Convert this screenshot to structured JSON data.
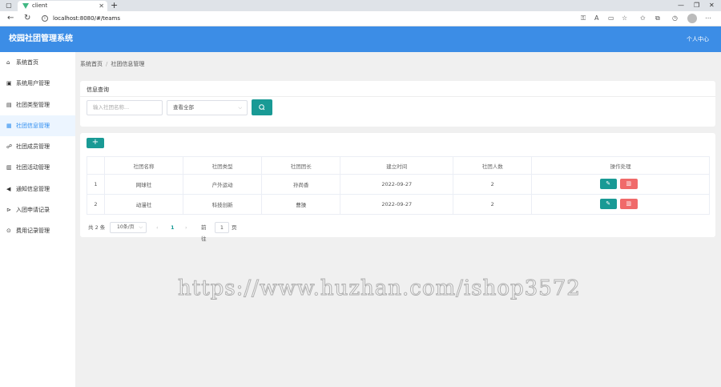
{
  "browser": {
    "tab_title": "client",
    "url": "localhost:8080/#/teams"
  },
  "app": {
    "title": "校园社团管理系统",
    "user_menu": "个人中心",
    "accent": "#3c8de6",
    "primary_button": "#199a95",
    "danger_button": "#f06a6a"
  },
  "sidebar": {
    "items": [
      {
        "label": "系统首页",
        "icon": "home-icon"
      },
      {
        "label": "系统用户管理",
        "icon": "user-icon"
      },
      {
        "label": "社团类型管理",
        "icon": "list-icon"
      },
      {
        "label": "社团信息管理",
        "icon": "doc-icon",
        "active": true
      },
      {
        "label": "社团成员管理",
        "icon": "members-icon"
      },
      {
        "label": "社团活动管理",
        "icon": "calendar-icon"
      },
      {
        "label": "通知信息管理",
        "icon": "megaphone-icon"
      },
      {
        "label": "入团申请记录",
        "icon": "apply-icon"
      },
      {
        "label": "费用记录管理",
        "icon": "coin-icon"
      }
    ]
  },
  "breadcrumb": [
    "系统首页",
    "社团信息管理"
  ],
  "search": {
    "title": "信息查询",
    "name_placeholder": "输入社团名称...",
    "type_select_value": "查看全部"
  },
  "table": {
    "columns": [
      "社团名称",
      "社团类型",
      "社团团长",
      "建立时间",
      "社团人数",
      "操作处理"
    ],
    "rows": [
      {
        "index": "1",
        "name": "网球社",
        "type": "户外运动",
        "leader": "孙尚香",
        "created": "2022-09-27",
        "members": "2"
      },
      {
        "index": "2",
        "name": "动漫社",
        "type": "科技创新",
        "leader": "曹操",
        "created": "2022-09-27",
        "members": "2"
      }
    ]
  },
  "pagination": {
    "total_text": "共 2 条",
    "page_size": "10条/页",
    "current_page": "1",
    "goto_label": "前往",
    "goto_value": "1",
    "page_unit": "页"
  },
  "watermark": "https://www.huzhan.com/ishop3572"
}
